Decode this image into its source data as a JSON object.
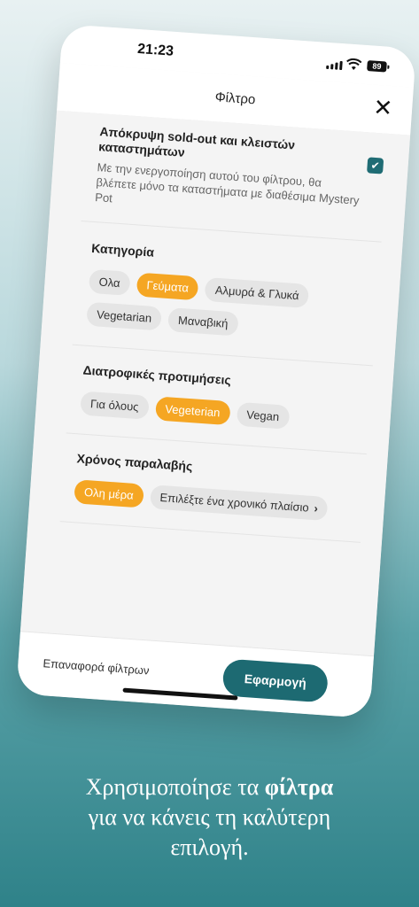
{
  "status_bar": {
    "time": "21:23",
    "battery": "89"
  },
  "header": {
    "title": "Φίλτρο",
    "close_icon": "close-icon"
  },
  "soldout": {
    "title": "Απόκρυψη sold-out και κλειστών καταστημάτων",
    "description": "Με την ενεργοποίηση αυτού του φίλτρου, θα βλέπετε μόνο τα καταστήματα με διαθέσιμα Mystery Pot",
    "checked": true
  },
  "category": {
    "title": "Κατηγορία",
    "options": [
      "Ολα",
      "Γεύματα",
      "Αλμυρά & Γλυκά",
      "Vegetarian",
      "Μαναβική"
    ],
    "selected": "Γεύματα"
  },
  "diet": {
    "title": "Διατροφικές προτιμήσεις",
    "options": [
      "Για όλους",
      "Vegeterian",
      "Vegan"
    ],
    "selected": "Vegeterian"
  },
  "pickup": {
    "title": "Χρόνος παραλαβής",
    "options": [
      "Ολη μέρα",
      "Επιλέξτε ένα χρονικό πλαίσιο"
    ],
    "selected": "Ολη μέρα"
  },
  "footer": {
    "reset_label": "Επαναφορά φίλτρων",
    "apply_label": "Εφαρμογή"
  },
  "caption": {
    "line1_pre": "Χρησιμοποίησε τα ",
    "line1_bold": "φίλτρα",
    "line2": "για να κάνεις τη καλύτερη",
    "line3": "επιλογή."
  },
  "colors": {
    "accent": "#f5a623",
    "primary": "#1d6a72"
  }
}
